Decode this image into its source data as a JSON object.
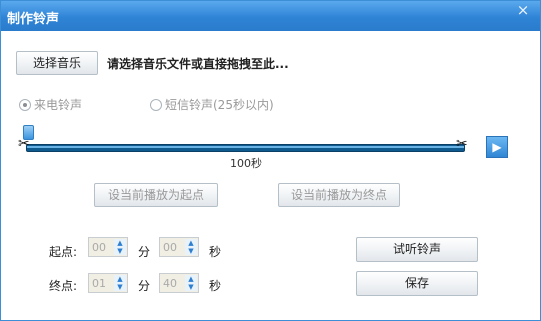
{
  "window": {
    "title": "制作铃声",
    "close_glyph": "×"
  },
  "toolbar": {
    "pick_music_label": "选择音乐",
    "prompt": "请选择音乐文件或直接拖拽至此..."
  },
  "ringtone_type": {
    "incoming_label": "来电铃声",
    "sms_label": "短信铃声(25秒以内)",
    "selected": "incoming"
  },
  "timeline": {
    "duration_label": "100秒",
    "play_glyph": "▶"
  },
  "set_buttons": {
    "set_start_label": "设当前播放为起点",
    "set_end_label": "设当前播放为终点"
  },
  "start": {
    "label": "起点:",
    "minutes": "00",
    "min_unit": "分",
    "seconds": "00",
    "sec_unit": "秒"
  },
  "end": {
    "label": "终点:",
    "minutes": "01",
    "min_unit": "分",
    "seconds": "40",
    "sec_unit": "秒"
  },
  "actions": {
    "listen_label": "试听铃声",
    "save_label": "保存"
  },
  "colors": {
    "title_bar": "#2f84d6",
    "track": "#0e5a8e",
    "play": "#2f86d4"
  }
}
